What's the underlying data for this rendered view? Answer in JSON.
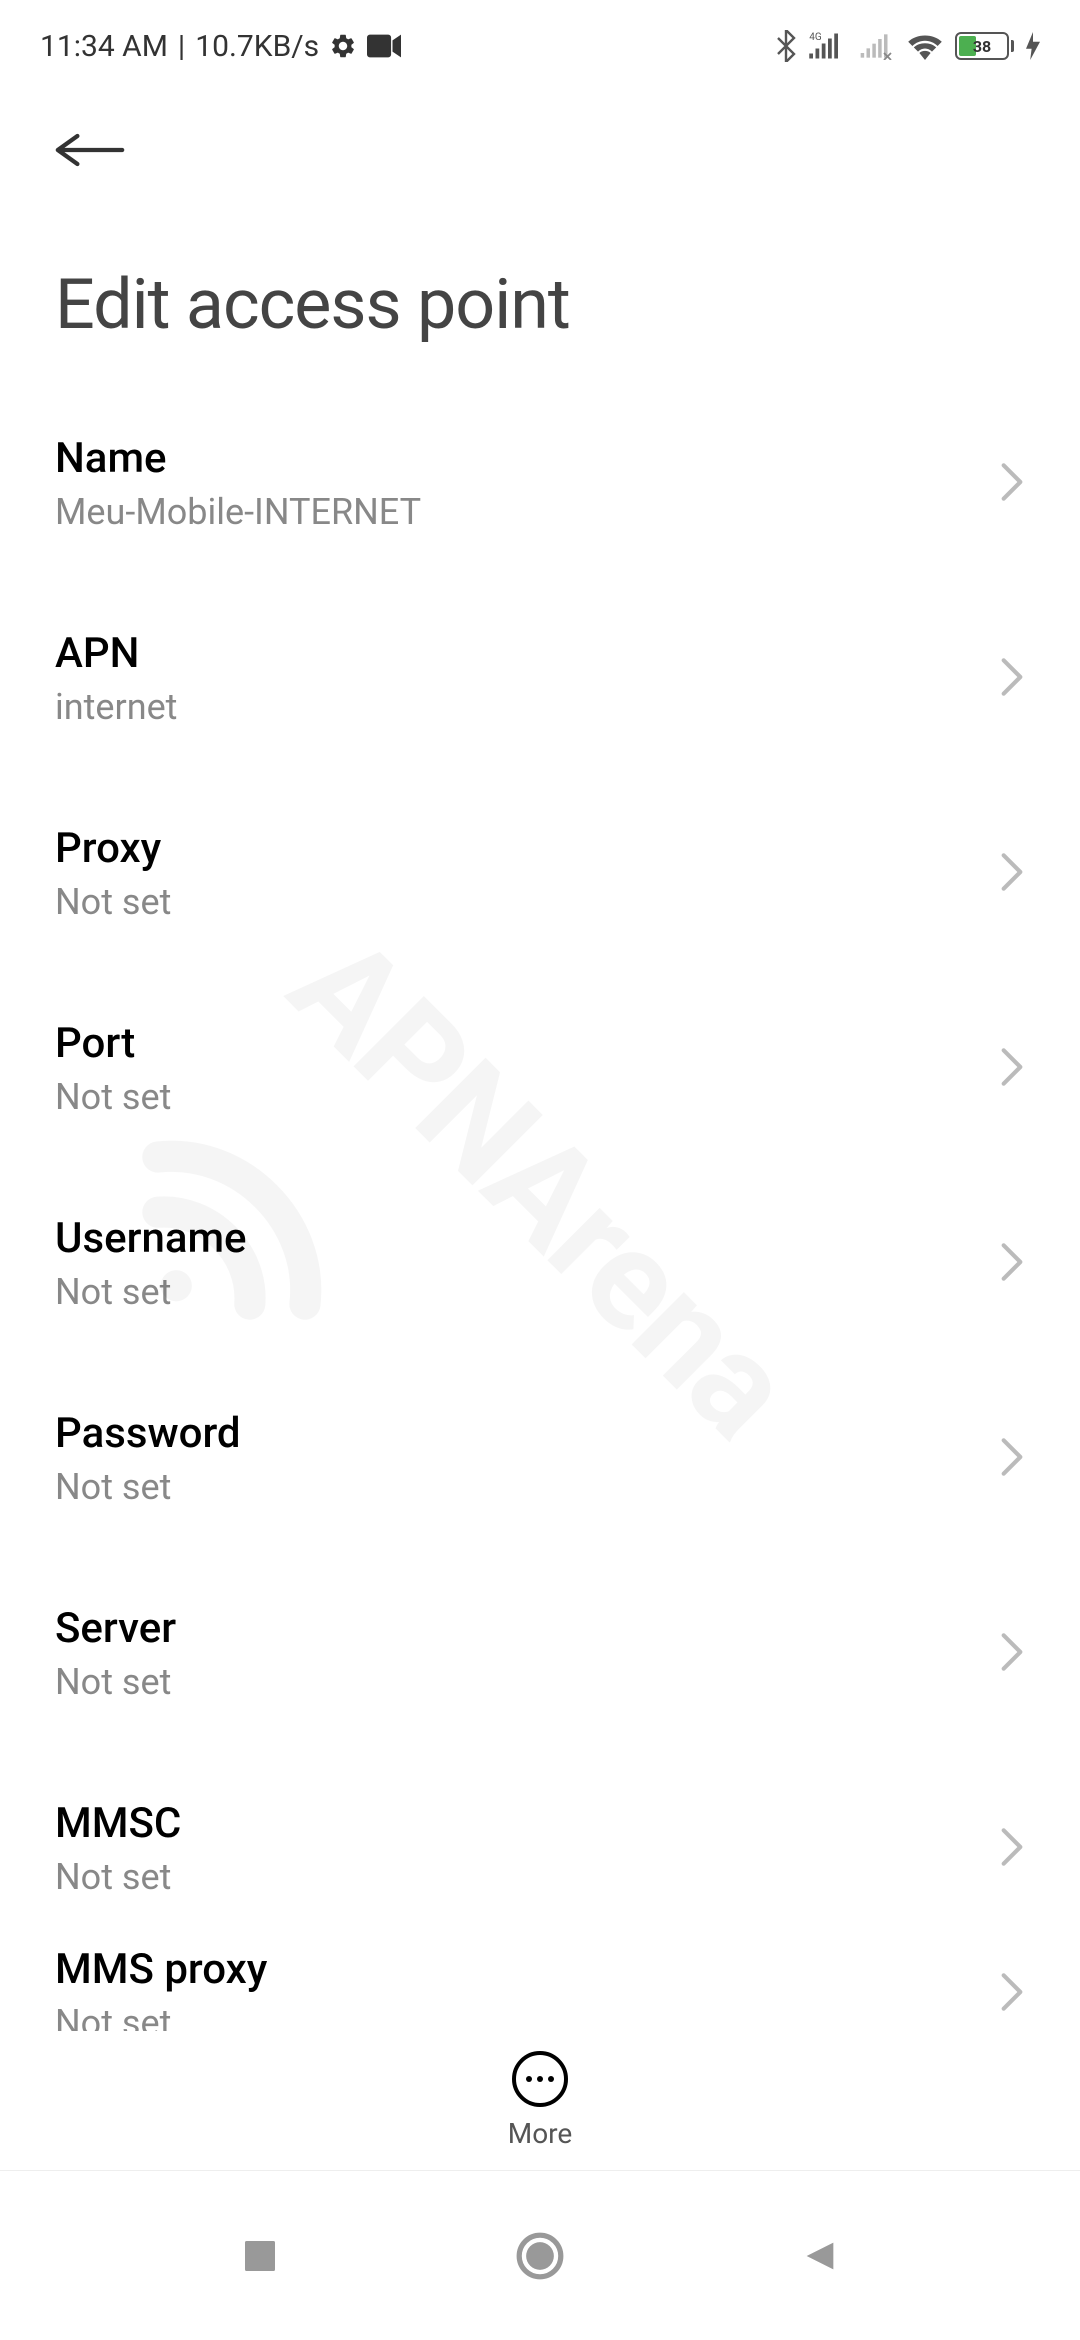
{
  "status_bar": {
    "time": "11:34 AM",
    "data_rate": "10.7KB/s",
    "battery_percent": "38",
    "network_type": "4G"
  },
  "header": {
    "title": "Edit access point"
  },
  "settings": [
    {
      "label": "Name",
      "value": "Meu-Mobile-INTERNET"
    },
    {
      "label": "APN",
      "value": "internet"
    },
    {
      "label": "Proxy",
      "value": "Not set"
    },
    {
      "label": "Port",
      "value": "Not set"
    },
    {
      "label": "Username",
      "value": "Not set"
    },
    {
      "label": "Password",
      "value": "Not set"
    },
    {
      "label": "Server",
      "value": "Not set"
    },
    {
      "label": "MMSC",
      "value": "Not set"
    },
    {
      "label": "MMS proxy",
      "value": "Not set"
    }
  ],
  "toolbar": {
    "more_label": "More"
  }
}
